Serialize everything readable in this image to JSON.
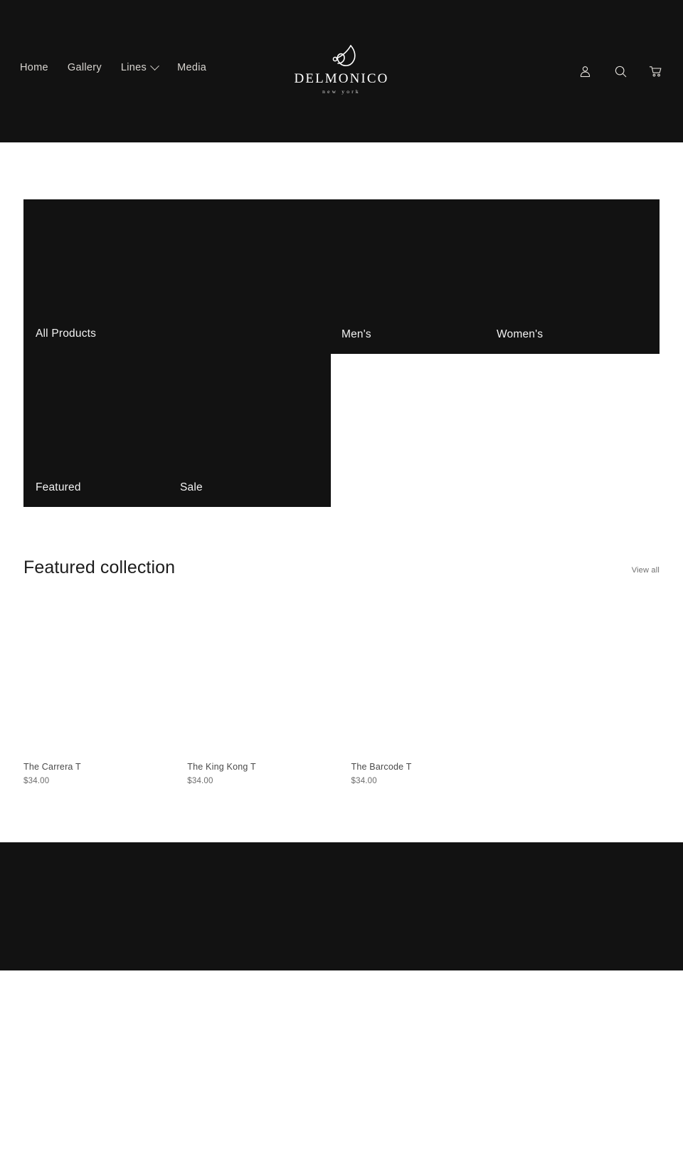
{
  "theme": {
    "dark_bg": "#121212",
    "page_bg": "#ffffff",
    "nav_text": "#d8d5d0",
    "body_text": "#4a4a4a"
  },
  "header": {
    "nav": [
      {
        "label": "Home",
        "has_dropdown": false
      },
      {
        "label": "Gallery",
        "has_dropdown": false
      },
      {
        "label": "Lines",
        "has_dropdown": true
      },
      {
        "label": "Media",
        "has_dropdown": false
      }
    ],
    "logo": {
      "mark": "delmonico-monogram",
      "name": "DELMONICO",
      "sub": "new york"
    },
    "icons": [
      {
        "name": "account-icon",
        "label": "Log in"
      },
      {
        "name": "search-icon",
        "label": "Search"
      },
      {
        "name": "cart-icon",
        "label": "Cart"
      }
    ]
  },
  "collections": {
    "top_block": {
      "name": "all-products",
      "labels": [
        {
          "text": "All Products"
        },
        {
          "text": "Men's"
        },
        {
          "text": "Women's"
        }
      ]
    },
    "lower_block": {
      "name": "featured-sale",
      "labels": [
        {
          "text": "Featured"
        },
        {
          "text": "Sale"
        }
      ]
    }
  },
  "featured": {
    "title": "Featured collection",
    "view_all": "View all",
    "products": [
      {
        "title": "The Carrera T",
        "price": "$34.00"
      },
      {
        "title": "The King Kong T",
        "price": "$34.00"
      },
      {
        "title": "The Barcode T",
        "price": "$34.00"
      },
      {
        "title": "",
        "price": ""
      }
    ]
  }
}
